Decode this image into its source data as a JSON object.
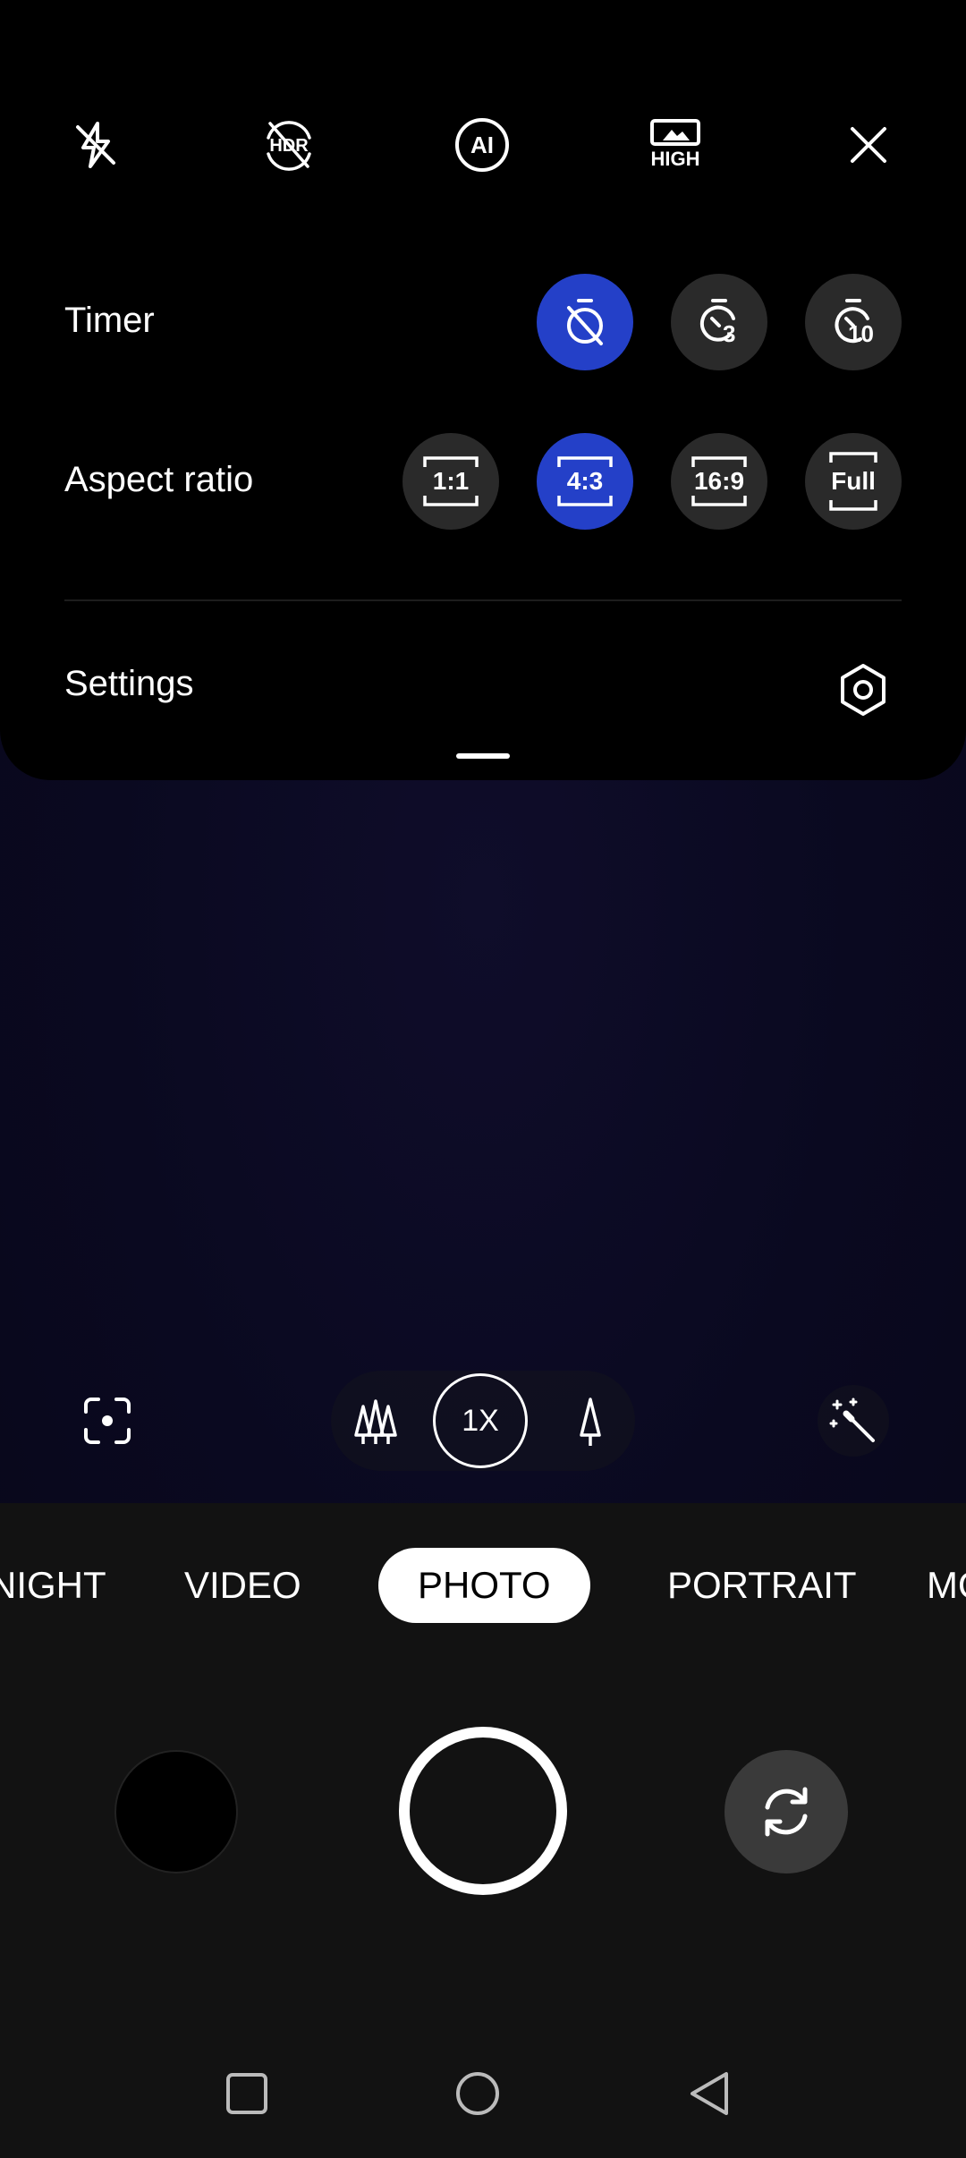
{
  "quick_toggles": {
    "flash_icon": "flash-off-icon",
    "hdr_icon": "hdr-off-icon",
    "ai_label": "AI",
    "quality_label": "HIGH",
    "close_icon": "close-icon"
  },
  "timer": {
    "label": "Timer",
    "options": [
      {
        "icon": "timer-off-icon",
        "label": "",
        "active": true
      },
      {
        "icon": "timer-3-icon",
        "label": "3",
        "active": false
      },
      {
        "icon": "timer-10-icon",
        "label": "10",
        "active": false
      }
    ]
  },
  "aspect_ratio": {
    "label": "Aspect ratio",
    "options": [
      {
        "label": "1:1",
        "active": false
      },
      {
        "label": "4:3",
        "active": true
      },
      {
        "label": "16:9",
        "active": false
      },
      {
        "label": "Full",
        "active": false
      }
    ]
  },
  "settings": {
    "label": "Settings",
    "icon": "settings-hexagon-icon"
  },
  "zoom": {
    "current": "1X",
    "wide_icon": "wide-angle-trees-icon",
    "tele_icon": "telephoto-tree-icon"
  },
  "modes": {
    "items": [
      "NIGHT",
      "VIDEO",
      "PHOTO",
      "PORTRAIT",
      "MO"
    ],
    "active": "PHOTO"
  },
  "colors": {
    "accent": "#2440c8",
    "panel": "#000000",
    "control_bg": "#2a2a2a",
    "bottom_bg": "#121212"
  }
}
